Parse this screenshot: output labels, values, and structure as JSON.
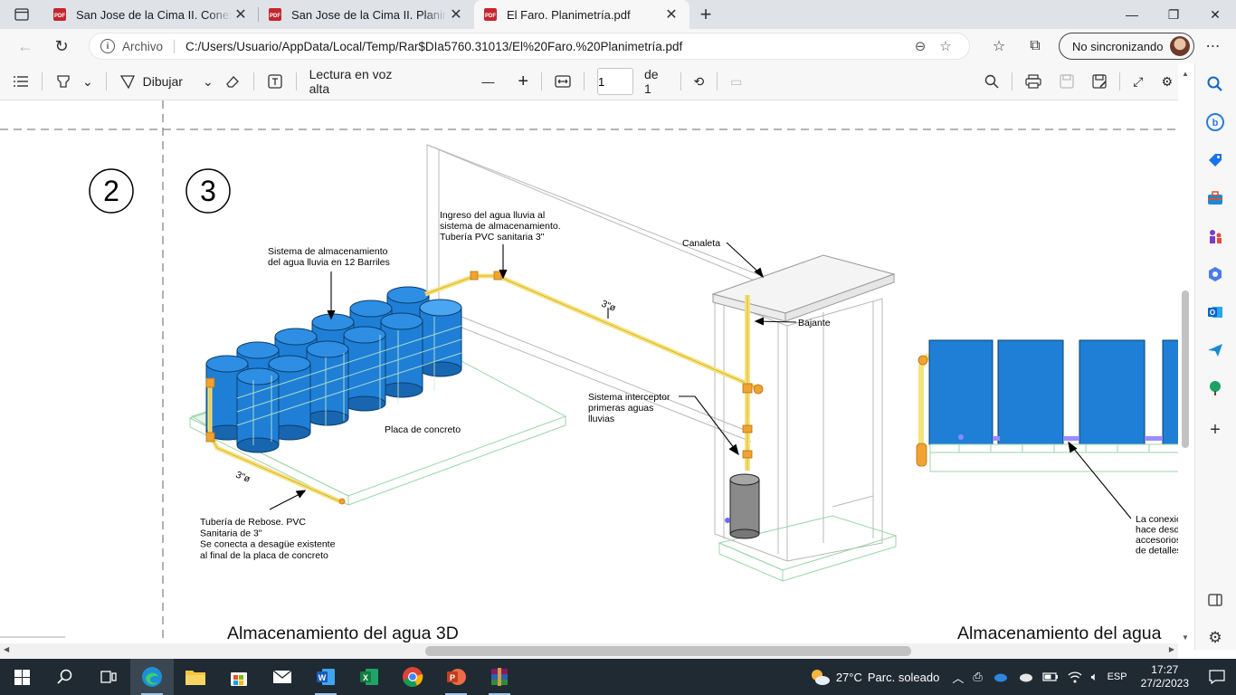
{
  "browser": {
    "tabs": [
      {
        "label": "San Jose de la Cima II. Conexione",
        "active": false
      },
      {
        "label": "San Jose de la Cima II. Planimetrí",
        "active": false
      },
      {
        "label": "El Faro. Planimetría.pdf",
        "active": true
      }
    ],
    "address": {
      "scheme_label": "Archivo",
      "url": "C:/Users/Usuario/AppData/Local/Temp/Rar$DIa5760.31013/El%20Faro.%20Planimetría.pdf"
    },
    "profile_label": "No sincronizando"
  },
  "pdf_toolbar": {
    "draw_label": "Dibujar",
    "read_aloud_label": "Lectura en voz alta",
    "page_current": "1",
    "page_total_label": "de 1"
  },
  "drawing": {
    "circle_2": "2",
    "circle_3": "3",
    "label_storage": [
      "Sistema de almacenamiento",
      "del agua lluvia en 12 Barriles"
    ],
    "label_inlet": [
      "Ingreso del agua lluvia al",
      "sistema de almacenamiento.",
      "Tubería PVC sanitaria 3\""
    ],
    "label_gutter": "Canaleta",
    "label_downspout": "Bajante",
    "label_pipe_size_1": "3\"ø",
    "label_pipe_size_2": "3\"ø",
    "label_slab": "Placa de concreto",
    "label_interceptor": [
      "Sistema interceptor",
      "primeras aguas",
      "lluvias"
    ],
    "label_overflow": [
      "Tubería de Rebose. PVC",
      "Sanitaria de 3\"",
      "Se conecta a desagüe existente",
      "al final de la placa de concreto"
    ],
    "label_connection": [
      "La conexió",
      "hace desd",
      "accesorios",
      "de detalles"
    ],
    "title_3d": "Almacenamiento del agua 3D",
    "title_right": "Almacenamiento del agua"
  },
  "taskbar": {
    "weather_temp": "27°C",
    "weather_desc": "Parc. soleado",
    "language": "ESP",
    "time": "17:27",
    "date": "27/2/2023"
  },
  "colors": {
    "barrel_blue": "#1f7fd6",
    "pipe_yellow": "#f7e27a",
    "pipe_orange": "#f0a330",
    "slab_green": "#9cd6a8"
  }
}
